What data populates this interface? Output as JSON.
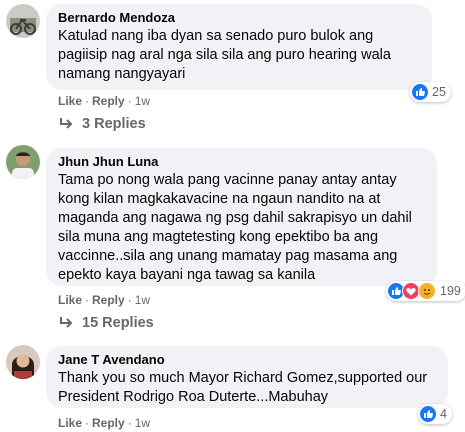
{
  "comments": [
    {
      "author": "Bernardo Mendoza",
      "text": "Katulad nang iba dyan sa senado puro bulok ang pagiisip nag aral nga sila sila ang puro hearing wala namang nangyayari",
      "like_label": "Like",
      "reply_label": "Reply",
      "time": "1w",
      "reaction_count": "25",
      "replies_label": "3 Replies"
    },
    {
      "author": "Jhun Jhun Luna",
      "text": "Tama po nong wala pang vacinne panay antay antay kong kilan magkakavacine na ngaun nandito na at maganda ang nagawa ng psg dahil sakrapisyo un dahil sila muna ang magtetesting kong epektibo ba ang vaccinne..sila ang unang mamatay pag masama ang epekto kaya bayani nga tawag sa kanila",
      "like_label": "Like",
      "reply_label": "Reply",
      "time": "1w",
      "reaction_count": "199",
      "replies_label": "15 Replies"
    },
    {
      "author": "Jane T Avendano",
      "text": "Thank you so much Mayor Richard Gomez,supported our President Rodrigo Roa Duterte...Mabuhay",
      "like_label": "Like",
      "reply_label": "Reply",
      "time": "1w",
      "reaction_count": "4"
    }
  ],
  "colors": {
    "bubble": "#f0f2f5",
    "meta_text": "#65676b",
    "like_blue": "#1877f2",
    "love_red": "#f33e58"
  }
}
